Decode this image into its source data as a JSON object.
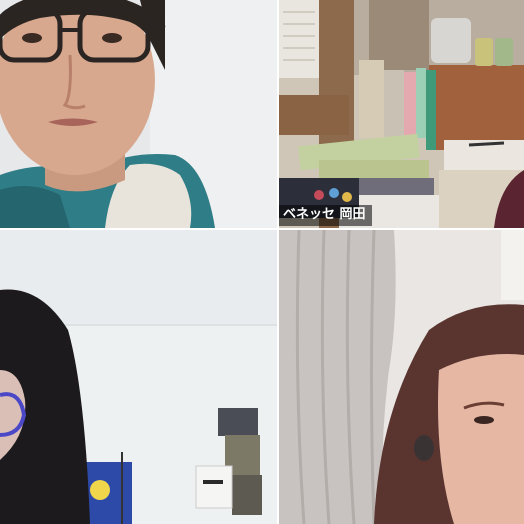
{
  "participants": [
    {
      "name": ""
    },
    {
      "name": "ベネッセ 岡田"
    },
    {
      "name": ""
    },
    {
      "name": ""
    }
  ],
  "colors": {
    "background": "#ffffff",
    "name_tag_bg": "#000000",
    "name_tag_text": "#ffffff"
  }
}
